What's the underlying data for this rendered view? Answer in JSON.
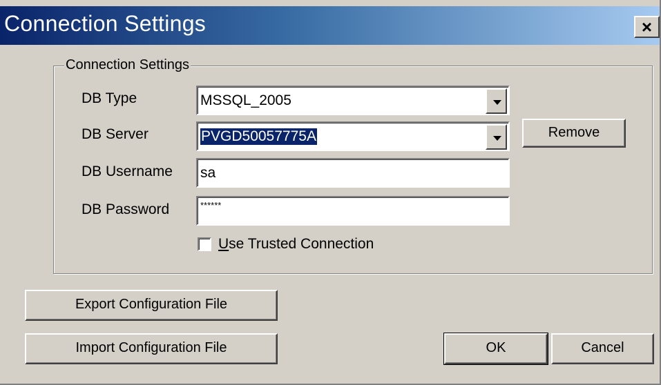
{
  "window": {
    "title": "Connection Settings",
    "close_label": "×"
  },
  "group": {
    "legend": "Connection Settings"
  },
  "fields": {
    "db_type": {
      "label": "DB Type",
      "value": "MSSQL_2005"
    },
    "db_server": {
      "label": "DB Server",
      "value": "PVGD50057775A",
      "selected": true
    },
    "db_username": {
      "label": "DB Username",
      "value": "sa"
    },
    "db_password": {
      "label": "DB Password",
      "value": "******"
    }
  },
  "trusted": {
    "label_mnemonic": "U",
    "label_rest": "se Trusted Connection",
    "checked": false
  },
  "buttons": {
    "remove": "Remove",
    "export": "Export Configuration File",
    "import": "Import Configuration File",
    "ok": "OK",
    "cancel": "Cancel"
  },
  "icons": {
    "dropdown": "chevron-down-icon",
    "close": "close-icon"
  }
}
